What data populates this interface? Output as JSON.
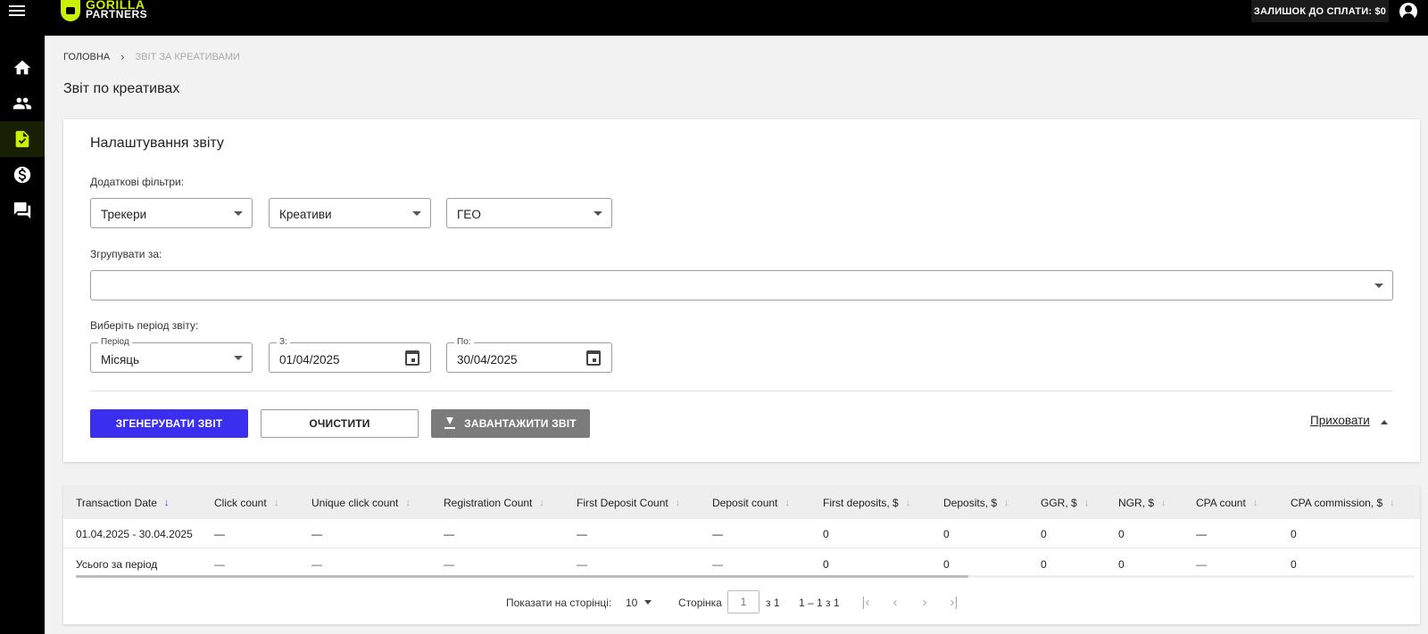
{
  "header": {
    "logo_line1": "GORILLA",
    "logo_line2": "PARTNERS",
    "balance_label": "ЗАЛИШОК ДО СПЛАТИ: $0"
  },
  "breadcrumb": {
    "home": "ГОЛОВНА",
    "separator": "›",
    "current": "ЗВІТ ЗА КРЕАТИВАМИ"
  },
  "page_title": "Звіт по креативах",
  "settings": {
    "title": "Налаштування звіту",
    "filters_label": "Додаткові фільтри:",
    "filters": {
      "trackers": "Трекери",
      "creatives": "Креативи",
      "geo": "ГЕО"
    },
    "group_label": "Згрупувати за:",
    "group_value": "",
    "period_section_label": "Виберіть період звіту:",
    "period": {
      "legend": "Період",
      "value": "Місяць"
    },
    "date_from": {
      "legend": "З:",
      "value": "01/04/2025"
    },
    "date_to": {
      "legend": "По:",
      "value": "30/04/2025"
    },
    "buttons": {
      "generate": "ЗГЕНЕРУВАТИ ЗВІТ",
      "clear": "ОЧИСТИТИ",
      "download": "ЗАВАНТАЖИТИ ЗВІТ"
    },
    "hide_link": "Приховати"
  },
  "table": {
    "columns": [
      "Transaction Date",
      "Click count",
      "Unique click count",
      "Registration Count",
      "First Deposit Count",
      "Deposit count",
      "First deposits, $",
      "Deposits, $",
      "GGR, $",
      "NGR, $",
      "CPA count",
      "CPA commission, $"
    ],
    "rows": [
      [
        "01.04.2025 - 30.04.2025",
        "—",
        "—",
        "—",
        "—",
        "—",
        "0",
        "0",
        "0",
        "0",
        "—",
        "0"
      ],
      [
        "Усього за період",
        "—",
        "—",
        "—",
        "—",
        "—",
        "0",
        "0",
        "0",
        "0",
        "—",
        "0"
      ]
    ]
  },
  "pager": {
    "per_page_label": "Показати на сторінці:",
    "per_page_value": "10",
    "page_label": "Сторінка",
    "page_value": "1",
    "of_label": "з 1",
    "range": "1 – 1 з 1"
  }
}
